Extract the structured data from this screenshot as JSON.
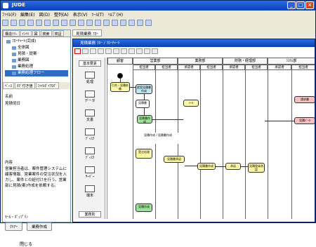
{
  "titlebar": {
    "title": "JUDE"
  },
  "menubar": {
    "items": [
      "ﾌｧｲﾙ(F)",
      "編集(E)",
      "図(D)",
      "整列(A)",
      "表示(V)",
      "ﾂｰﾙ(T)",
      "ﾍﾙﾌﾟ(H)"
    ]
  },
  "left_panel": {
    "tabs": [
      "構造ﾂﾘｰ",
      "ｲﾝﾍﾘ",
      "図",
      "検索",
      "検証"
    ],
    "tree": [
      "ﾌﾛｰﾁｬｰﾄ(完成)",
      "全体図",
      "見積・提案",
      "業務図",
      "業務処理",
      "業務処理フロー"
    ],
    "prop_tabs": [
      "ﾍﾞｰｽ",
      "ﾀｸﾞ付き値",
      "ﾌｧｲﾙﾀﾞｲｱﾛｸﾞ"
    ],
    "name_label": "名前",
    "name_value": "見積伺日",
    "desc_label": "内容",
    "desc_text": "営業担当者は、案件管理システムに顧客情報、営業案件の受注状況を入力し、案件との紐付けを行う。営業部に見積(案)作成を依頼する。",
    "bottom_label": "ﾓｰﾙ・ﾎﾟｯﾌﾟﾘﾝ",
    "btn_left": "ｸﾘｱｰ",
    "btn_right": "業務作成",
    "close_label": "閉じる"
  },
  "doc_tab": "見積業務 ﾌﾛｰ",
  "inner_window": {
    "title": "見積業務 ﾌﾛｰ / ﾌﾛｰﾁｬｰﾄ"
  },
  "palette": {
    "header": "基本要素",
    "items": [
      "処理",
      "データ",
      "文書",
      "ﾃﾞｨｽｸ",
      "ﾃﾞｨｽｸ",
      "ｻｰﾊﾞｰ",
      "端末"
    ],
    "footer": "業務別"
  },
  "diagram": {
    "lanes": [
      "顧客",
      "営業部",
      "業務部",
      "財務・経理部",
      "ｼｽﾃﾑ部"
    ],
    "sublanes": [
      "担当者",
      "担当者",
      "承認者",
      "担当者",
      "承認者",
      "担当者",
      "承認者",
      "担当者"
    ],
    "boxes": [
      "引合・見積依頼",
      "提案見積書作成",
      "見積書",
      "見積書作成",
      "ﾒｰﾙ",
      "見積作成 / 見積書作成",
      "受注処理",
      "見積書承認",
      "見積書作成",
      "承認",
      "見積登録承認",
      "請求書",
      "見積ﾃﾞｰﾀ",
      "見積作成"
    ]
  }
}
